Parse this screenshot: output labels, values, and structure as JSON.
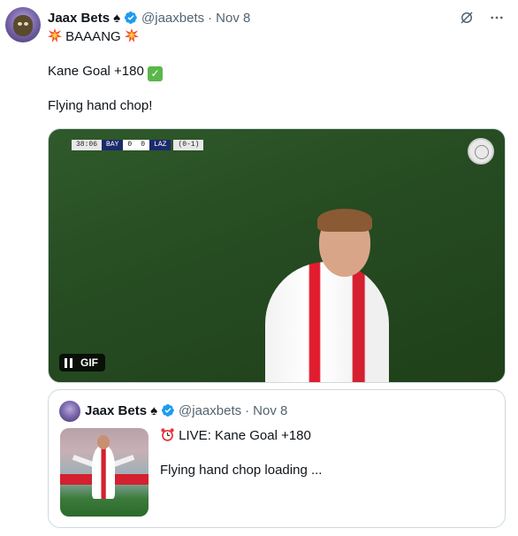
{
  "author": {
    "name": "Jaax Bets",
    "badge_glyph": "♠",
    "handle": "@jaaxbets",
    "separator": "·",
    "date": "Nov 8"
  },
  "tweet": {
    "line1_text": "BAAANG",
    "line2_text": "Kane Goal +180",
    "line3_text": "Flying hand chop!"
  },
  "media": {
    "scorebug": {
      "clock": "38:06",
      "home": "BAY",
      "home_score": "0",
      "away_score": "0",
      "away": "LAZ",
      "aggregate": "(0-1)"
    },
    "gif_label": "GIF"
  },
  "quote": {
    "name": "Jaax Bets",
    "badge_glyph": "♠",
    "handle": "@jaaxbets",
    "separator": "·",
    "date": "Nov 8",
    "line1_text": "LIVE: Kane Goal +180",
    "line2_text": "Flying hand chop loading ..."
  },
  "icons": {
    "verified": "verified-badge-icon",
    "grok": "grok-icon",
    "more": "more-icon",
    "collision": "collision-emoji-icon",
    "check": "check-mark-emoji-icon",
    "alarm": "alarm-clock-emoji-icon",
    "pause": "pause-icon"
  },
  "colors": {
    "text": "#0f1419",
    "secondary": "#536471",
    "verified_blue": "#1d9bf0",
    "border": "#cfd9de",
    "check_green": "#5bb74b"
  }
}
